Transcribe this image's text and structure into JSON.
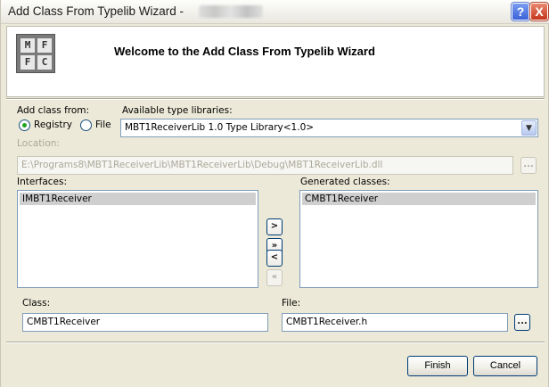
{
  "window": {
    "title": "Add Class From Typelib Wizard -"
  },
  "titlebar_buttons": {
    "help_glyph": "?",
    "close_glyph": "X"
  },
  "header": {
    "welcome": "Welcome to the Add Class From Typelib Wizard",
    "logo_letters": [
      "M",
      "F",
      "F",
      "C"
    ]
  },
  "add_class_from": {
    "label": "Add class from:",
    "registry_label": "Registry",
    "file_label": "File",
    "selected": "Registry"
  },
  "available_libs": {
    "label": "Available type libraries:",
    "value": "MBT1ReceiverLib 1.0 Type Library<1.0>"
  },
  "location": {
    "label": "Location:",
    "value": "E:\\Programs8\\MBT1ReceiverLib\\MBT1ReceiverLib\\Debug\\MBT1ReceiverLib.dll",
    "browse_label": "..."
  },
  "interfaces": {
    "label": "Interfaces:",
    "items": [
      "IMBT1Receiver"
    ]
  },
  "generated": {
    "label": "Generated classes:",
    "items": [
      "CMBT1Receiver"
    ]
  },
  "move_buttons": {
    "add_one": ">",
    "add_all": "»",
    "remove_one": "<",
    "remove_all": "«"
  },
  "class": {
    "label": "Class:",
    "value": "CMBT1Receiver"
  },
  "file": {
    "label": "File:",
    "value": "CMBT1Receiver.h",
    "browse_label": "..."
  },
  "footer": {
    "finish": "Finish",
    "cancel": "Cancel"
  }
}
